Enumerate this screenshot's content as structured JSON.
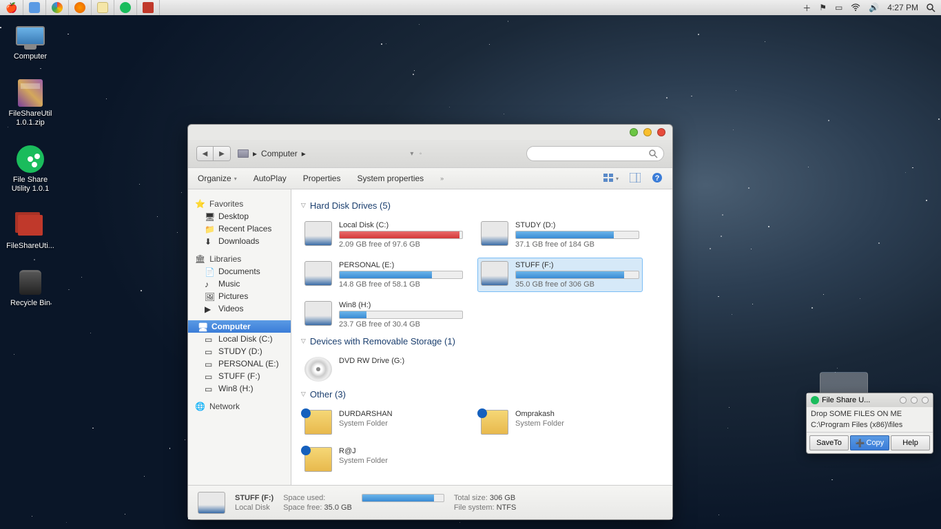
{
  "menubar": {
    "time": "4:27 PM"
  },
  "desktop": [
    {
      "label": "Computer",
      "icon": "monitor"
    },
    {
      "label": "FileShareUtil 1.0.1.zip",
      "icon": "winrar"
    },
    {
      "label": "File Share Utility 1.0.1",
      "icon": "green"
    },
    {
      "label": "FileShareUti...",
      "icon": "folderred"
    },
    {
      "label": "Recycle Bin",
      "icon": "trash"
    }
  ],
  "explorer": {
    "breadcrumb": "Computer",
    "menu": {
      "organize": "Organize",
      "autoplay": "AutoPlay",
      "properties": "Properties",
      "sysprops": "System properties"
    },
    "sidebar": {
      "favorites": {
        "head": "Favorites",
        "items": [
          "Desktop",
          "Recent Places",
          "Downloads"
        ]
      },
      "libraries": {
        "head": "Libraries",
        "items": [
          "Documents",
          "Music",
          "Pictures",
          "Videos"
        ]
      },
      "computer": {
        "head": "Computer",
        "items": [
          "Local Disk (C:)",
          "STUDY (D:)",
          "PERSONAL (E:)",
          "STUFF (F:)",
          "Win8 (H:)"
        ]
      },
      "network": {
        "head": "Network"
      }
    },
    "groups": {
      "hdd": {
        "title": "Hard Disk Drives (5)",
        "drives": [
          {
            "name": "Local Disk (C:)",
            "free": "2.09 GB free of 97.6 GB",
            "pct": 98,
            "red": true
          },
          {
            "name": "STUDY (D:)",
            "free": "37.1 GB free of 184 GB",
            "pct": 80
          },
          {
            "name": "PERSONAL (E:)",
            "free": "14.8 GB free of 58.1 GB",
            "pct": 75
          },
          {
            "name": "STUFF (F:)",
            "free": "35.0 GB free of 306 GB",
            "pct": 88,
            "sel": true
          },
          {
            "name": "Win8 (H:)",
            "free": "23.7 GB free of 30.4 GB",
            "pct": 22
          }
        ]
      },
      "removable": {
        "title": "Devices with Removable Storage (1)",
        "drives": [
          {
            "name": "DVD RW Drive (G:)",
            "icon": "dvd"
          }
        ]
      },
      "other": {
        "title": "Other (3)",
        "drives": [
          {
            "name": "DURDARSHAN",
            "sub": "System Folder",
            "icon": "bt"
          },
          {
            "name": "Omprakash",
            "sub": "System Folder",
            "icon": "bt"
          },
          {
            "name": "R@J",
            "sub": "System Folder",
            "icon": "bt"
          }
        ]
      }
    },
    "status": {
      "name": "STUFF (F:)",
      "type": "Local Disk",
      "spaceused_lbl": "Space used:",
      "spacefree_lbl": "Space free:",
      "spacefree": "35.0 GB",
      "totalsize_lbl": "Total size:",
      "totalsize": "306 GB",
      "fs_lbl": "File system:",
      "fs": "NTFS"
    }
  },
  "fswin": {
    "title": "File Share U...",
    "line1": "Drop SOME FILES ON ME",
    "line2": "C:\\Program Files (x86)\\files",
    "btns": {
      "saveto": "SaveTo",
      "copy": "Copy",
      "help": "Help"
    }
  }
}
